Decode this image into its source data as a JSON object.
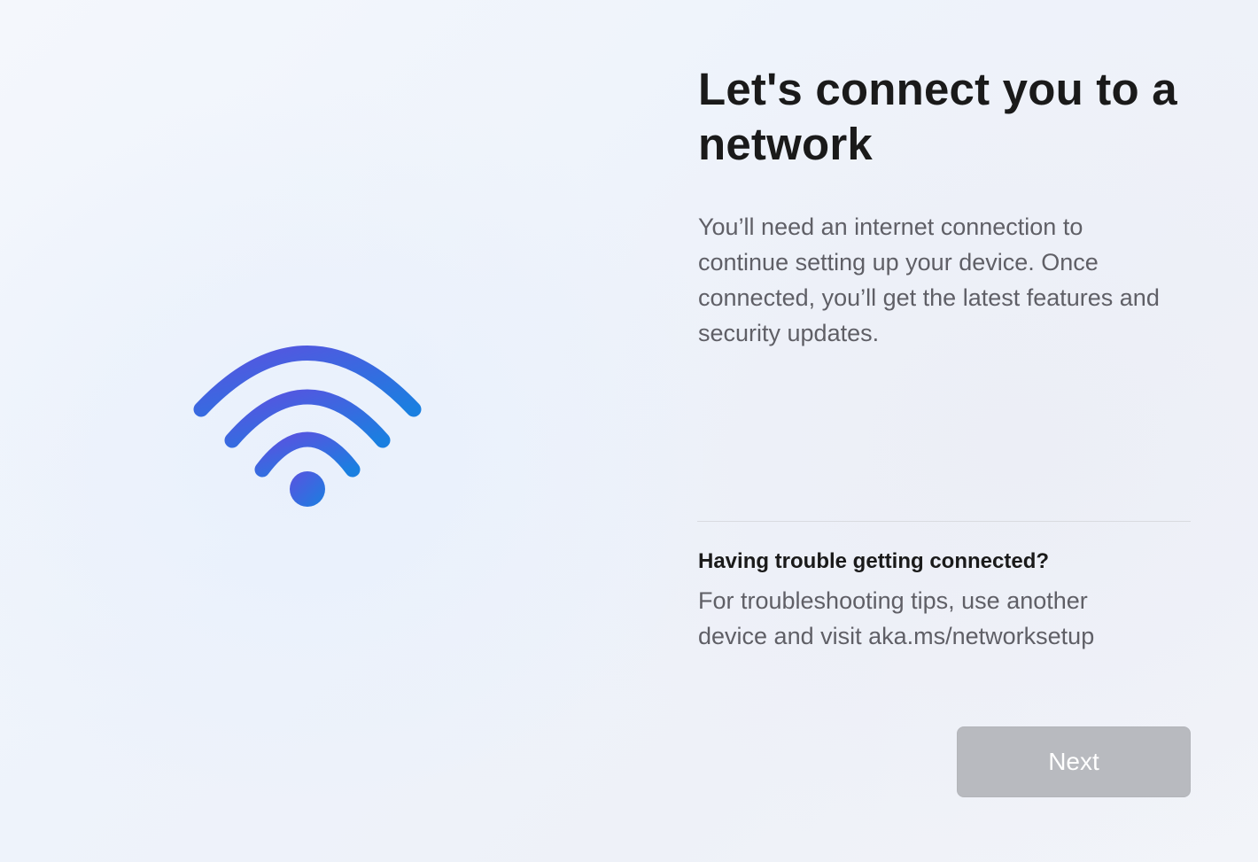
{
  "page": {
    "title": "Let's connect you to a network",
    "description": "You’ll need an internet connection to continue setting up your device. Once connected, you’ll get the latest features and security updates."
  },
  "illustration": {
    "icon": "wifi-icon",
    "colors": {
      "gradient_start": "#5a52e0",
      "gradient_end": "#1a7fe0"
    }
  },
  "help": {
    "title": "Having trouble getting connected?",
    "text": "For troubleshooting tips, use another device and visit aka.ms/networksetup"
  },
  "actions": {
    "next_label": "Next",
    "next_enabled": false
  },
  "colors": {
    "button_disabled_bg": "#b8babf",
    "button_text": "#ffffff",
    "body_text": "#5f5f66",
    "heading_text": "#1a1a1a"
  }
}
